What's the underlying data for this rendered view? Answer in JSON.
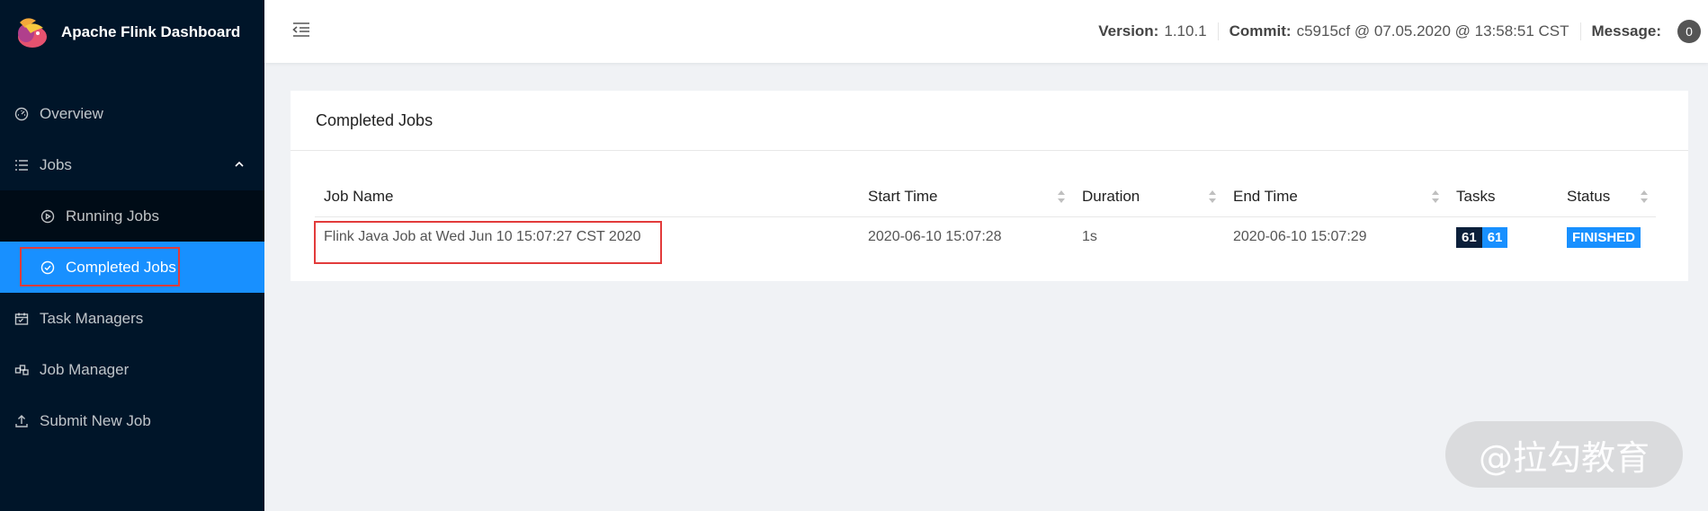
{
  "app": {
    "title": "Apache Flink Dashboard"
  },
  "sidebar": {
    "items": [
      {
        "label": "Overview",
        "icon": "dashboard-icon"
      },
      {
        "label": "Jobs",
        "icon": "list-icon"
      },
      {
        "label": "Running Jobs",
        "icon": "play-circle-icon"
      },
      {
        "label": "Completed Jobs",
        "icon": "check-circle-icon"
      },
      {
        "label": "Task Managers",
        "icon": "calendar-icon"
      },
      {
        "label": "Job Manager",
        "icon": "cluster-icon"
      },
      {
        "label": "Submit New Job",
        "icon": "upload-icon"
      }
    ],
    "active": "Completed Jobs"
  },
  "header": {
    "version_label": "Version:",
    "version": "1.10.1",
    "commit_label": "Commit:",
    "commit": "c5915cf @ 07.05.2020 @ 13:58:51 CST",
    "message_label": "Message:",
    "message_count": "0"
  },
  "card": {
    "title": "Completed Jobs",
    "columns": [
      "Job Name",
      "Start Time",
      "Duration",
      "End Time",
      "Tasks",
      "Status"
    ],
    "rows": [
      {
        "job_name": "Flink Java Job at Wed Jun 10 15:07:27 CST 2020",
        "start_time": "2020-06-10 15:07:28",
        "duration": "1s",
        "end_time": "2020-06-10 15:07:29",
        "tasks_total": "61",
        "tasks_finished": "61",
        "status": "FINISHED"
      }
    ]
  },
  "watermark": "@拉勾教育",
  "colors": {
    "sidebar": "#001529",
    "accent": "#1890ff",
    "highlight": "#e23b3b"
  }
}
